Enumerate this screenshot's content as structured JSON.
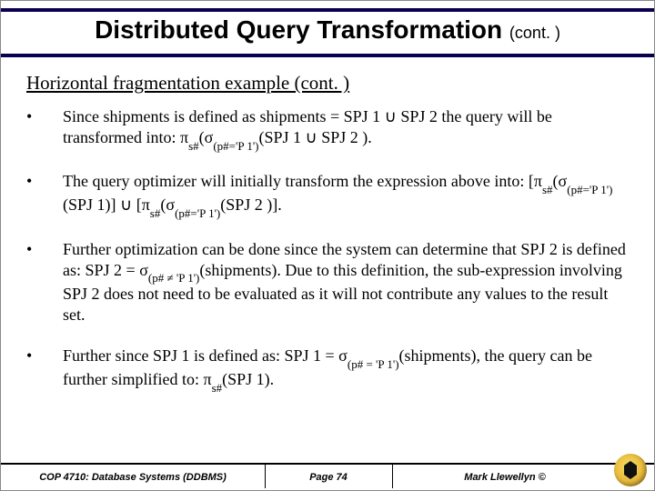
{
  "title": "Distributed Query Transformation",
  "title_cont": "(cont. )",
  "subtitle": "Horizontal fragmentation example (cont. )",
  "bullets": [
    {
      "pre": "Since shipments is defined as  shipments = SPJ 1 ",
      "u1": "∪",
      "mid1": " SPJ 2  the query will be transformed into: ",
      "pi1": "π",
      "sub1": "s#",
      "lp1": "(",
      "sig1": "σ",
      "sub2": "(p#='P 1')",
      "post1": "(SPJ 1 ",
      "u2": "∪",
      "post2": " SPJ 2 )."
    },
    {
      "pre": "The query optimizer will initially transform the expression above into: [",
      "pi1": "π",
      "sub1": "s#",
      "lp1": "(",
      "sig1": "σ",
      "sub2": "(p#='P 1')",
      "mid1": "(SPJ 1)] ",
      "u1": "∪",
      "mid2": " [",
      "pi2": "π",
      "sub3": "s#",
      "lp2": "(",
      "sig2": "σ",
      "sub4": "(p#='P 1')",
      "post1": "(SPJ 2 )]."
    },
    {
      "pre": "Further optimization can be done since the system can determine that SPJ 2 is defined as: SPJ 2 = ",
      "sig1": "σ",
      "sub1": "(p# ≠ 'P 1')",
      "mid1": "(shipments).  Due to this definition, the sub-expression involving SPJ 2 does not need to be evaluated as it will not contribute any values to the result set."
    },
    {
      "pre": "Further since SPJ 1 is defined as: SPJ 1 = ",
      "sig1": "σ",
      "sub1": "(p# = 'P 1')",
      "mid1": "(shipments), the query can be further simplified to: ",
      "pi1": "π",
      "sub2": "s#",
      "post1": "(SPJ 1)."
    }
  ],
  "footer": {
    "course": "COP 4710: Database Systems  (DDBMS)",
    "page": "Page 74",
    "author": "Mark Llewellyn ©"
  }
}
